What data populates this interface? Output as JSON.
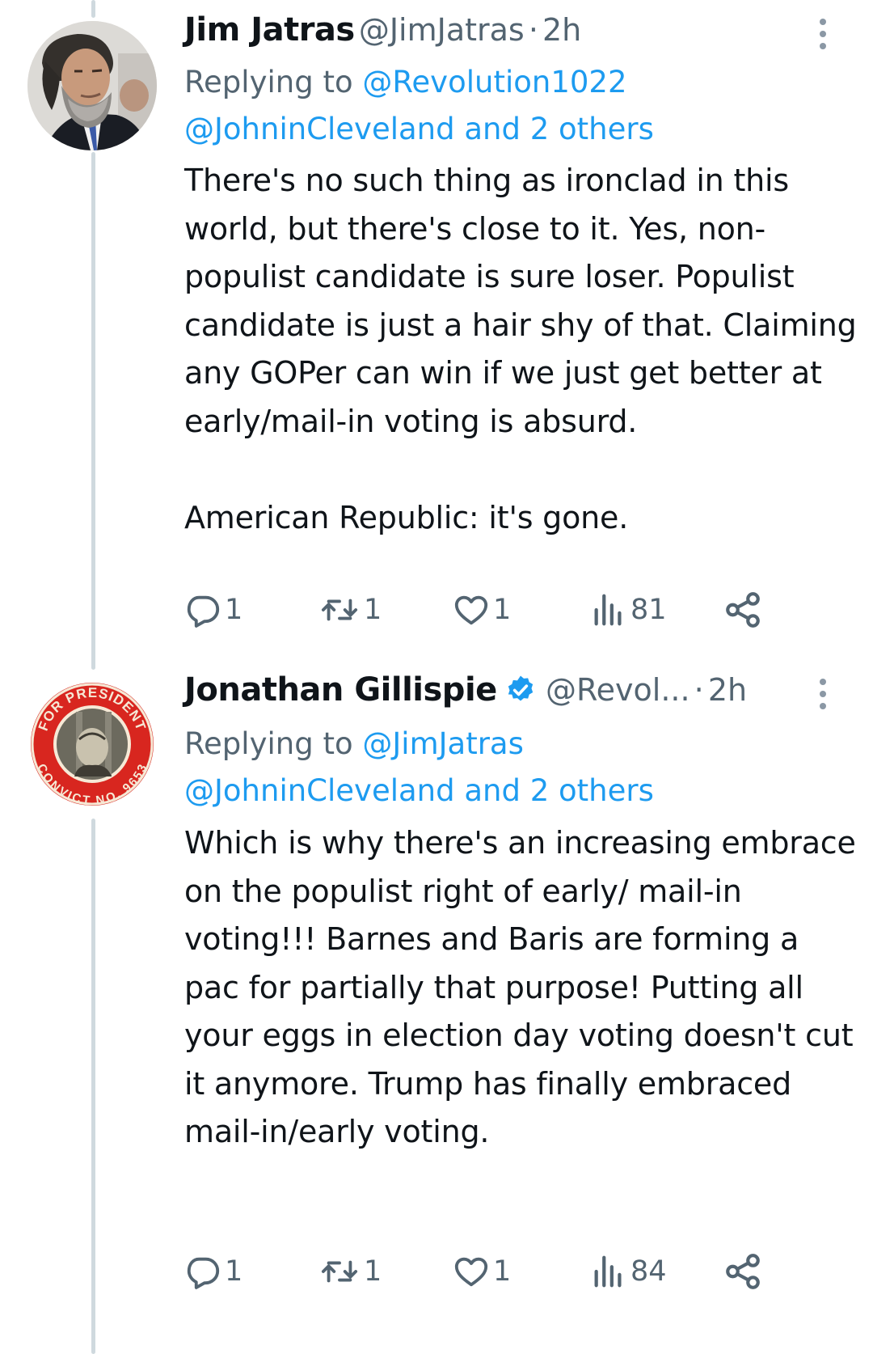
{
  "colors": {
    "link": "#1d9bf0",
    "muted": "#536471",
    "text": "#0f1419",
    "thread_line": "#cfd9de",
    "verified": "#1d9bf0"
  },
  "tweets": [
    {
      "name": "Jim Jatras",
      "handle": "@JimJatras",
      "separator": "·",
      "time": "2h",
      "verified": false,
      "replying_prefix": "Replying to",
      "reply_mention_1": "@Revolution1022",
      "reply_mention_2": "@JohninCleveland and 2 others",
      "text": "There's no such thing as ironclad in this world, but there's close to it. Yes, non-populist candidate is sure loser. Populist candidate is just a hair shy of that. Claiming any GOPer can win if we just get better at early/mail-in voting is absurd.\n\nAmerican Republic: it's gone.",
      "replies": "1",
      "reposts": "1",
      "likes": "1",
      "views": "81"
    },
    {
      "name": "Jonathan Gillispie",
      "handle": "@Revol...",
      "separator": "·",
      "time": "2h",
      "verified": true,
      "replying_prefix": "Replying to",
      "reply_mention_1": "@JimJatras",
      "reply_mention_2": "@JohninCleveland and 2 others",
      "text": "Which is why there's an increasing embrace on the populist right of early/ mail-in voting!!! Barnes and Baris are forming a pac for partially that purpose! Putting all your eggs in election day voting doesn't cut it anymore. Trump has finally embraced mail-in/early voting.",
      "replies": "1",
      "reposts": "1",
      "likes": "1",
      "views": "84"
    }
  ],
  "avatar_2_badge": {
    "top_text": "FOR PRESIDENT",
    "bottom_text": "CONVICT NO. 9653"
  }
}
